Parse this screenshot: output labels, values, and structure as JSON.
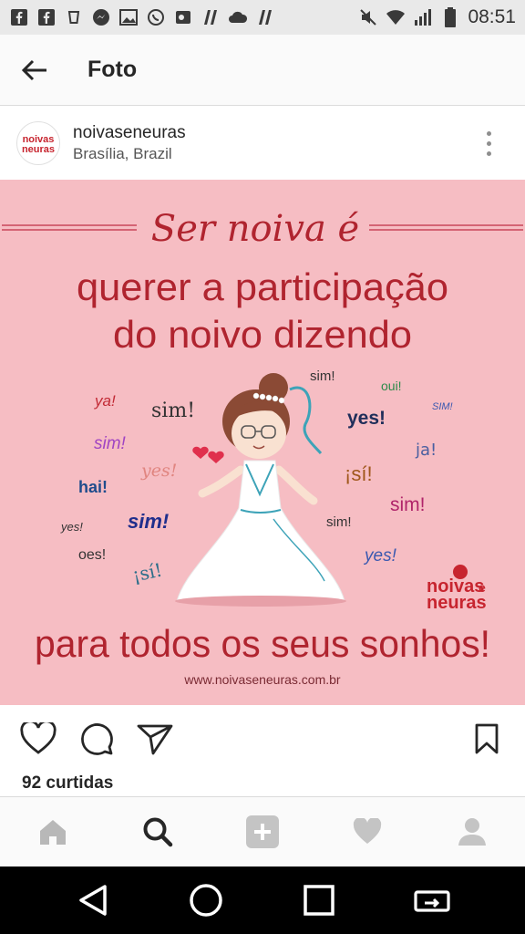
{
  "status_bar": {
    "time": "08:51",
    "icons": [
      "facebook-icon",
      "facebook-icon",
      "cup-icon",
      "messenger-icon",
      "gallery-icon",
      "whatsapp-icon",
      "outlook-icon",
      "app-icon",
      "cloud-icon",
      "app-icon",
      "mute-icon",
      "wifi-icon",
      "signal-icon",
      "battery-icon"
    ]
  },
  "header": {
    "title": "Foto"
  },
  "post": {
    "username": "noivaseneuras",
    "location": "Brasília, Brazil",
    "avatar_logo_top": "noivas",
    "avatar_logo_bottom": "neuras",
    "image": {
      "headline": "Ser noiva é",
      "line1": "querer a participação",
      "line2": "do noivo dizendo",
      "bottom_line": "para todos os seus sonhos!",
      "website": "www.noivaseneuras.com.br",
      "logo_top": "noivas",
      "logo_bottom": "neuras",
      "logo_e": "e",
      "words": {
        "w1": "ya!",
        "w2": "sim!",
        "w3": "sim!",
        "w4": "yes!",
        "w5": "hai!",
        "w6": "yes!",
        "w7": "oes!",
        "w8": "sim!",
        "w9": "¡sí!",
        "w10": "sim!",
        "w11": "oui!",
        "w12": "SIM!",
        "w13": "yes!",
        "w14": "ja!",
        "w15": "¡sí!",
        "w16": "sim!",
        "w17": "sim!",
        "w18": "yes!"
      },
      "colors": {
        "background": "#f6bdc3",
        "title_red": "#b0242f"
      }
    },
    "likes": "92 curtidas"
  },
  "bottom_nav": [
    "home-icon",
    "search-icon",
    "add-icon",
    "heart-icon",
    "profile-icon"
  ],
  "system_nav": [
    "back-icon",
    "home-circle-icon",
    "recents-icon",
    "screen-cast-icon"
  ]
}
